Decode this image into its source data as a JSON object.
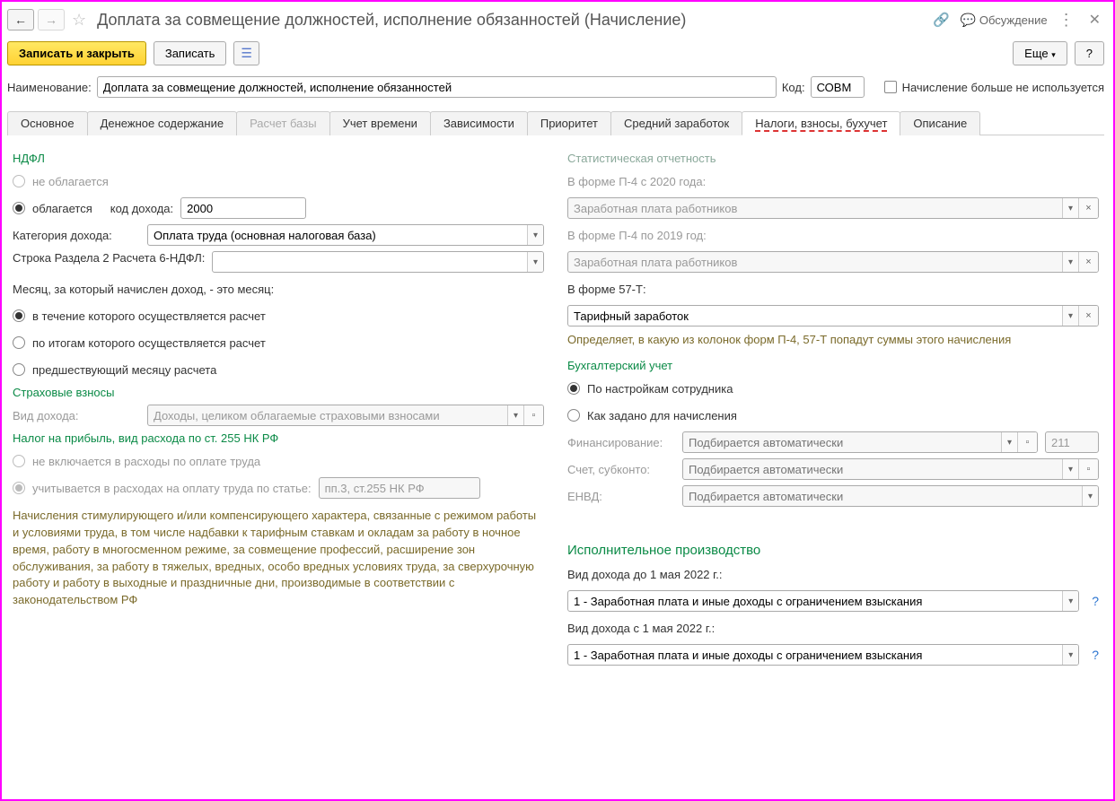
{
  "title": "Доплата за совмещение должностей, исполнение обязанностей (Начисление)",
  "title_actions": {
    "discuss": "Обсуждение"
  },
  "cmd": {
    "save_close": "Записать и закрыть",
    "save": "Записать",
    "more": "Еще",
    "help": "?"
  },
  "main_fields": {
    "name_label": "Наименование:",
    "name_value": "Доплата за совмещение должностей, исполнение обязанностей",
    "code_label": "Код:",
    "code_value": "СОВМ",
    "not_used_label": "Начисление больше не используется"
  },
  "tabs": [
    "Основное",
    "Денежное содержание",
    "Расчет базы",
    "Учет времени",
    "Зависимости",
    "Приоритет",
    "Средний заработок",
    "Налоги, взносы, бухучет",
    "Описание"
  ],
  "active_tab_index": 7,
  "disabled_tab_index": 2,
  "left": {
    "sec_ndfl": "НДФЛ",
    "r_not_taxed": "не облагается",
    "r_taxed": "облагается",
    "income_code_label": "код дохода:",
    "income_code_value": "2000",
    "cat_label": "Категория дохода:",
    "cat_value": "Оплата труда (основная налоговая база)",
    "row2_label": "Строка Раздела 2 Расчета 6-НДФЛ:",
    "row2_value": "",
    "month_label": "Месяц, за который начислен доход, - это месяц:",
    "m1": "в течение которого осуществляется расчет",
    "m2": "по итогам которого осуществляется расчет",
    "m3": "предшествующий месяцу расчета",
    "sec_ins": "Страховые взносы",
    "ins_type_label": "Вид дохода:",
    "ins_type_value": "Доходы, целиком облагаемые страховыми взносами",
    "sec_profit": "Налог на прибыль, вид расхода по ст. 255 НК РФ",
    "p_not": "не включается в расходы по оплате труда",
    "p_yes": "учитывается в расходах на оплату труда по статье:",
    "p_article": "пп.3, ст.255 НК РФ",
    "note": "Начисления стимулирующего и/или компенсирующего характера, связанные с режимом работы и условиями труда, в том числе надбавки к тарифным ставкам и окладам за работу в ночное время, работу в многосменном режиме, за совмещение профессий, расширение зон обслуживания, за работу в тяжелых, вредных, особо вредных условиях труда, за сверхурочную работу и работу в выходные и праздничные дни, производимые в соответствии с законодательством РФ"
  },
  "right": {
    "sec_stat": "Статистическая отчетность",
    "p4_2020_label": "В форме П-4 с 2020 года:",
    "p4_2020_value": "Заработная плата работников",
    "p4_2019_label": "В форме П-4 по 2019 год:",
    "p4_2019_value": "Заработная плата работников",
    "f57t_label": "В форме 57-Т:",
    "f57t_value": "Тарифный заработок",
    "stat_note": "Определяет, в какую из колонок форм П-4, 57-Т попадут суммы этого начисления",
    "sec_acc": "Бухгалтерский учет",
    "acc_r1": "По настройкам сотрудника",
    "acc_r2": "Как задано для начисления",
    "fin_label": "Финансирование:",
    "fin_ph": "Подбирается автоматически",
    "acc_label": "Счет, субконто:",
    "acc_ph": "Подбирается автоматически",
    "acc_val211": "211",
    "envd_label": "ЕНВД:",
    "envd_ph": "Подбирается автоматически",
    "sec_exec": "Исполнительное производство",
    "exec_before_label": "Вид дохода до 1 мая 2022 г.:",
    "exec_before_value": "1 - Заработная плата и иные доходы с ограничением взыскания",
    "exec_after_label": "Вид дохода с 1 мая 2022 г.:",
    "exec_after_value": "1 - Заработная плата и иные доходы с ограничением взыскания"
  }
}
